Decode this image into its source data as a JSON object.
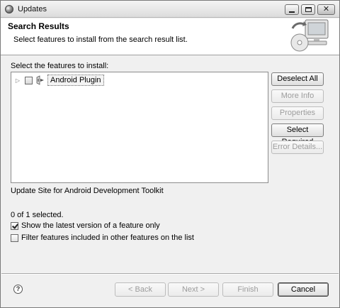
{
  "window": {
    "title": "Updates"
  },
  "header": {
    "title": "Search Results",
    "description": "Select features to install from the search result list."
  },
  "features": {
    "section_label": "Select the features to install:",
    "items": [
      {
        "label": "Android Plugin",
        "checked": false,
        "expanded": false
      }
    ],
    "description": "Update Site for Android Development Toolkit",
    "selection_count": "0 of 1 selected."
  },
  "side_buttons": {
    "deselect_all": "Deselect All",
    "more_info": "More Info",
    "properties": "Properties",
    "select_required": "Select Required",
    "error_details": "Error Details..."
  },
  "options": {
    "show_latest": {
      "label": "Show the latest version of a feature only",
      "checked": true
    },
    "filter_included": {
      "label": "Filter features included in other features on the list",
      "checked": false
    }
  },
  "nav": {
    "back": "< Back",
    "next": "Next >",
    "finish": "Finish",
    "cancel": "Cancel"
  },
  "icons": {
    "app": "eclipse-icon",
    "help": "help-icon",
    "feature": "feature-plugin-icon",
    "wizard": "update-computer-graphic"
  }
}
